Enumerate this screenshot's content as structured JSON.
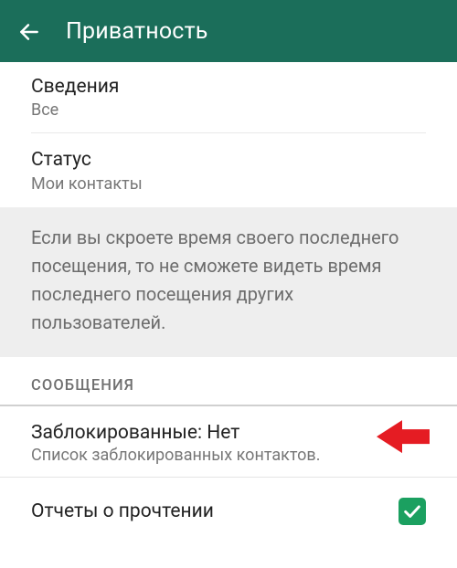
{
  "header": {
    "title": "Приватность"
  },
  "settings": {
    "about": {
      "title": "Сведения",
      "value": "Все"
    },
    "status": {
      "title": "Статус",
      "value": "Мои контакты"
    }
  },
  "info_text": "Если вы скроете время своего последнего посещения, то не сможете видеть время последнего посещения других пользователей.",
  "section_messages": "СООБЩЕНИЯ",
  "blocked": {
    "title": "Заблокированные: Нет",
    "sub": "Список заблокированных контактов."
  },
  "read_receipts": {
    "title": "Отчеты о прочтении",
    "checked": true
  },
  "colors": {
    "header_bg": "#1b6e5a",
    "accent": "#1ba060",
    "arrow": "#e51c23"
  }
}
